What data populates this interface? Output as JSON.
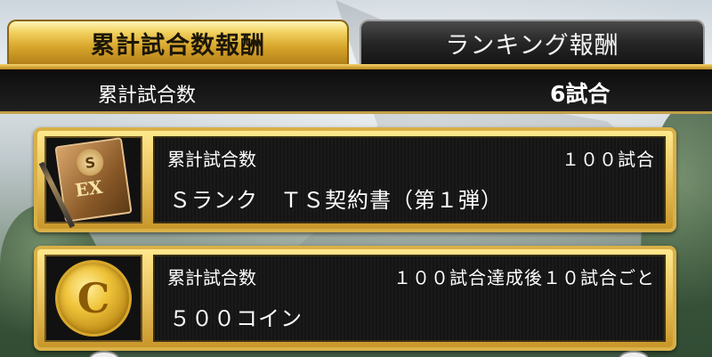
{
  "tabs": [
    {
      "label": "累計試合数報酬",
      "active": true
    },
    {
      "label": "ランキング報酬",
      "active": false
    }
  ],
  "summary": {
    "label": "累計試合数",
    "value": "6試合"
  },
  "rewards": [
    {
      "label": "累計試合数",
      "condition": "１００試合",
      "name": "Ｓランク　ＴＳ契約書（第１弾）",
      "icon": "contract-document-icon",
      "icon_text": {
        "seal": "S",
        "mark": "EX"
      }
    },
    {
      "label": "累計試合数",
      "condition": "１００試合達成後１０試合ごと",
      "name": "５００コイン",
      "icon": "coin-icon",
      "icon_text": {
        "mark": "C"
      }
    }
  ],
  "colors": {
    "accent_gold": "#d9b048",
    "panel_dark": "#141414",
    "tab_inactive": "#262626"
  }
}
